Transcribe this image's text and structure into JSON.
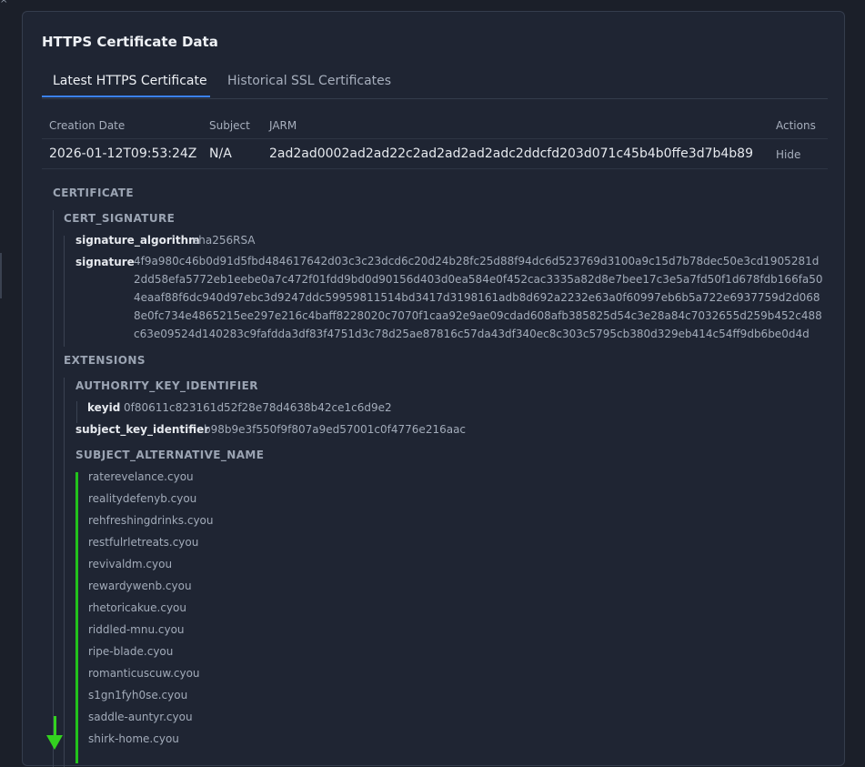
{
  "panel": {
    "title": "HTTPS Certificate Data",
    "tabs": [
      {
        "label": "Latest HTTPS Certificate",
        "active": true
      },
      {
        "label": "Historical SSL Certificates",
        "active": false
      }
    ]
  },
  "table": {
    "headers": [
      "Creation Date",
      "Subject",
      "JARM",
      "Actions"
    ],
    "row": {
      "creation_date": "2026-01-12T09:53:24Z",
      "subject": "N/A",
      "jarm": "2ad2ad0002ad2ad22c2ad2ad2ad2adc2ddcfd203d071c45b4b0ffe3d7b4b89",
      "action": "Hide"
    }
  },
  "certificate": {
    "label": "CERTIFICATE",
    "cert_signature": {
      "label": "CERT_SIGNATURE",
      "signature_algorithm_key": "signature_algorithm",
      "signature_algorithm": "sha256RSA",
      "signature_key": "signature",
      "signature": "4f9a980c46b0d91d5fbd484617642d03c3c23dcd6c20d24b28fc25d88f94dc6d523769d3100a9c15d7b78dec50e3cd1905281d2dd58efa5772eb1eebe0a7c472f01fdd9bd0d90156d403d0ea584e0f452cac3335a82d8e7bee17c3e5a7fd50f1d678fdb166fa504eaaf88f6dc940d97ebc3d9247ddc59959811514bd3417d3198161adb8d692a2232e63a0f60997eb6b5a722e6937759d2d0688e0fc734e4865215ee297e216c4baff8228020c7070f1caa92e9ae09cdad608afb385825d54c3e28a84c7032655d259b452c488c63e09524d140283c9fafdda3df83f4751d3c78d25ae87816c57da43df340ec8c303c5795cb380d329eb414c54ff9db6be0d4d"
    },
    "extensions": {
      "label": "EXTENSIONS",
      "authority_key_identifier": {
        "label": "AUTHORITY_KEY_IDENTIFIER",
        "keyid_key": "keyid",
        "keyid": "0f80611c823161d52f28e78d4638b42ce1c6d9e2"
      },
      "subject_key_identifier_key": "subject_key_identifier",
      "subject_key_identifier": "b98b9e3f550f9f807a9ed57001c0f4776e216aac",
      "subject_alternative_name": {
        "label": "SUBJECT_ALTERNATIVE_NAME",
        "items": [
          "raterevelance.cyou",
          "realitydefenyb.cyou",
          "rehfreshingdrinks.cyou",
          "restfulrletreats.cyou",
          "revivaldm.cyou",
          "rewardywenb.cyou",
          "rhetoricakue.cyou",
          "riddled-mnu.cyou",
          "ripe-blade.cyou",
          "romanticuscuw.cyou",
          "s1gn1fyh0se.cyou",
          "saddle-auntyr.cyou",
          "shirk-home.cyou"
        ]
      }
    }
  },
  "colors": {
    "accent": "#3b82f6",
    "highlight": "#22c21c"
  },
  "icons": [
    "down-arrow-icon"
  ]
}
